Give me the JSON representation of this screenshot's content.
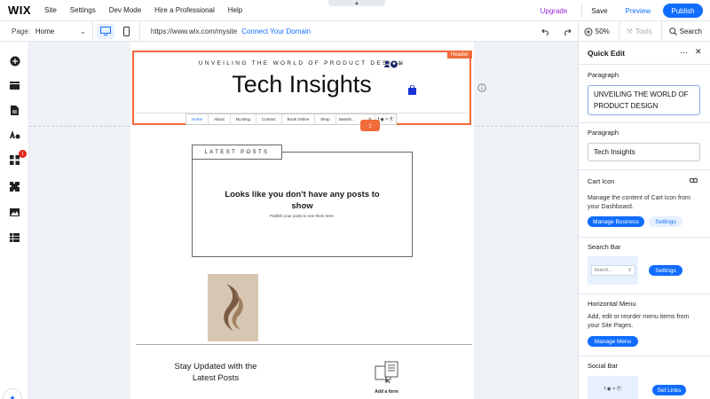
{
  "topbar": {
    "logo": "WIX",
    "menu": [
      "Site",
      "Settings",
      "Dev Mode",
      "Hire a Professional",
      "Help"
    ],
    "upgrade": "Upgrade",
    "save": "Save",
    "preview": "Preview",
    "publish": "Publish"
  },
  "toolbar": {
    "page_label": "Page:",
    "page_name": "Home",
    "url": "https://www.wix.com/mysite",
    "connect_domain": "Connect Your Domain",
    "zoom": "50%",
    "tools": "Tools",
    "search": "Search"
  },
  "canvas": {
    "header_tag": "Header",
    "tagline": "UNVEILING THE WORLD OF PRODUCT DESIGN",
    "site_title": "Tech Insights",
    "nav_items": [
      "Home",
      "About",
      "My Blog",
      "Contact",
      "Book Online",
      "Shop"
    ],
    "nav_search": "Search...",
    "posts_label": "LATEST POSTS",
    "empty_title": "Looks like you don't have any posts to show",
    "empty_sub": "Publish your posts to see them here.",
    "stay_updated": "Stay Updated with the Latest Posts",
    "add_form": "Add a form"
  },
  "panel": {
    "title": "Quick Edit",
    "paragraph1_label": "Paragraph",
    "paragraph1_value": "UNVEILING THE WORLD OF PRODUCT DESIGN",
    "paragraph2_label": "Paragraph",
    "paragraph2_value": "Tech Insights",
    "cart_label": "Cart Icon",
    "cart_desc": "Manage the content of Cart Icon from your Dashboard.",
    "manage_business": "Manage Business",
    "settings": "Settings",
    "search_bar_label": "Search Bar",
    "search_placeholder": "Search...",
    "search_settings": "Settings",
    "hmenu_label": "Horizontal Menu",
    "hmenu_desc": "Add, edit or reorder menu items from your Site Pages.",
    "manage_menu": "Manage Menu",
    "social_label": "Social Bar",
    "set_links": "Set Links"
  },
  "colors": {
    "accent": "#116dff",
    "selection": "#f26b3a",
    "upgrade": "#9a27d5"
  }
}
